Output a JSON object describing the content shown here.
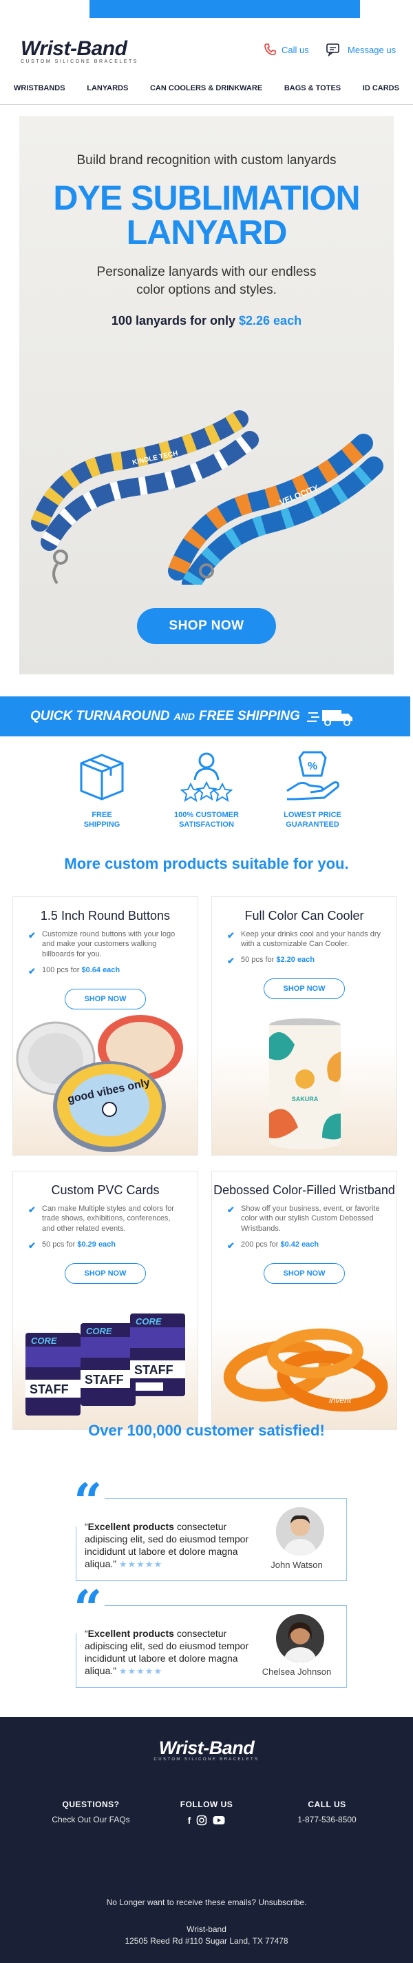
{
  "brand": {
    "name": "Wrist-Band",
    "tagline": "CUSTOM  SILICONE  BRACELETS"
  },
  "header": {
    "call_label": "Call us",
    "message_label": "Message us"
  },
  "nav": [
    "WRISTBANDS",
    "LANYARDS",
    "CAN COOLERS & DRINKWARE",
    "BAGS & TOTES",
    "ID CARDS"
  ],
  "hero": {
    "kicker": "Build brand recognition with custom lanyards",
    "title_line1": "DYE SUBLIMATION",
    "title_line2": "LANYARD",
    "description": "Personalize lanyards with our endless color options and styles.",
    "price_prefix": "100 lanyards for only ",
    "price_value": "$2.26 each",
    "cta": "SHOP NOW",
    "lanyard_text_1": "KINDLE TECH",
    "lanyard_text_2": "VELOCITY"
  },
  "shipping_banner": {
    "part1": "QUICK TURNAROUND",
    "and": "AND",
    "part2": "FREE SHIPPING"
  },
  "features": [
    {
      "icon": "box-icon",
      "label_1": "FREE",
      "label_2": "SHIPPING"
    },
    {
      "icon": "satisfaction-icon",
      "label_1": "100% CUSTOMER",
      "label_2": "SATISFACTION"
    },
    {
      "icon": "price-hand-icon",
      "label_1": "LOWEST PRICE",
      "label_2": "GUARANTEED"
    }
  ],
  "more_title": "More custom products suitable for you.",
  "products": [
    {
      "title": "1.5 Inch Round Buttons",
      "desc": "Customize round buttons with your logo and make your customers walking billboards for you.",
      "price_prefix": "100 pcs for ",
      "price": "$0.64 each",
      "cta": "SHOP NOW",
      "art_text": "good vibes only"
    },
    {
      "title": "Full Color Can Cooler",
      "desc": "Keep your drinks cool and your hands dry with a customizable Can Cooler.",
      "price_prefix": "50 pcs for ",
      "price": "$2.20 each",
      "cta": "SHOP NOW",
      "art_text": "SAKURA"
    },
    {
      "title": "Custom PVC Cards",
      "desc": "Can make Multiple styles and colors for trade shows, exhibitions, conferences, and other related events.",
      "price_prefix": "50 pcs for ",
      "price": "$0.29 each",
      "cta": "SHOP NOW",
      "art_text_1": "CORE",
      "art_text_2": "STAFF"
    },
    {
      "title": "Debossed Color-Filled Wristband",
      "desc": "Show off your business, event, or favorite color with our stylish Custom Debossed Wristbands.",
      "price_prefix": "200 pcs for ",
      "price": "$0.42 each",
      "cta": "SHOP NOW",
      "art_text": "invent"
    }
  ],
  "satisfied_title": "Over 100,000 customer satisfied!",
  "reviews": [
    {
      "bold": "Excellent products",
      "text": " consectetur adipiscing elit, sed do eiusmod tempor incididunt ut labore et dolore magna aliqua.",
      "open_quote": "“",
      "close_quote": "”",
      "stars": "★★★★★",
      "name": "John Watson"
    },
    {
      "bold": "Excellent products",
      "text": " consectetur adipiscing elit, sed do eiusmod tempor incididunt ut labore et dolore magna aliqua.",
      "open_quote": "“",
      "close_quote": "”",
      "stars": "★★★★★",
      "name": "Chelsea Johnson"
    }
  ],
  "footer": {
    "questions_heading": "QUESTIONS?",
    "questions_link": "Check Out Our FAQs",
    "follow_heading": "FOLLOW US",
    "call_heading": "CALL US",
    "phone": "1-877-536-8500",
    "unsubscribe": "No Longer want to receive these emails? Unsubscribe.",
    "company": "Wrist-band",
    "address": "12505 Reed Rd #110 Sugar Land, TX 77478"
  },
  "colors": {
    "accent": "#1e8ef0",
    "dark": "#1a2035"
  }
}
